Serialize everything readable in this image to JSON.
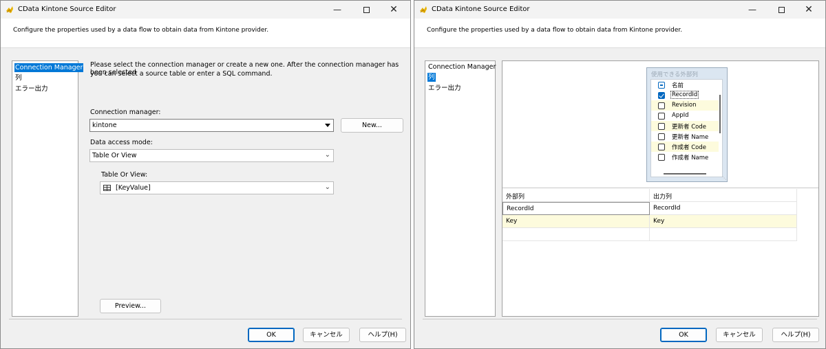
{
  "left_window": {
    "title": "CData Kintone Source Editor",
    "description": "Configure the properties used by a data flow to obtain data from Kintone provider.",
    "nav_items": [
      "Connection Manager",
      "列",
      "エラー出力"
    ],
    "instructions_line1": "Please select the connection manager or create a new one. After the connection manager has been selected",
    "instructions_line2": "you can select a source table or enter a SQL command.",
    "connection_manager_label": "Connection manager:",
    "connection_manager_value": "kintone",
    "new_button": "New...",
    "data_access_mode_label": "Data access mode:",
    "data_access_mode_value": "Table Or View",
    "table_or_view_label": "Table Or View:",
    "table_or_view_value": "[KeyValue]",
    "preview_button": "Preview...",
    "ok_button": "OK",
    "cancel_button": "キャンセル",
    "help_button": "ヘルプ(H)"
  },
  "right_window": {
    "title": "CData Kintone Source Editor",
    "description": "Configure the properties used by a data flow to obtain data from Kintone provider.",
    "nav_items": [
      "Connection Manager",
      "列",
      "エラー出力"
    ],
    "available_columns_title": "使用できる外部列",
    "columns": [
      {
        "label": "名前",
        "state": "partial"
      },
      {
        "label": "RecordId",
        "state": "checked"
      },
      {
        "label": "Revision",
        "state": "unchecked"
      },
      {
        "label": "AppId",
        "state": "unchecked"
      },
      {
        "label": "更新者 Code",
        "state": "unchecked"
      },
      {
        "label": "更新者 Name",
        "state": "unchecked"
      },
      {
        "label": "作成者 Code",
        "state": "unchecked"
      },
      {
        "label": "作成者 Name",
        "state": "unchecked"
      }
    ],
    "grid_headers": [
      "外部列",
      "出力列"
    ],
    "grid_rows": [
      [
        "RecordId",
        "RecordId"
      ],
      [
        "Key",
        "Key"
      ]
    ],
    "ok_button": "OK",
    "cancel_button": "キャンセル",
    "help_button": "ヘルプ(H)"
  },
  "colors": {
    "selection": "#0078d7",
    "default_button_border": "#0067c0",
    "highlight_row": "#fdfbdd"
  }
}
